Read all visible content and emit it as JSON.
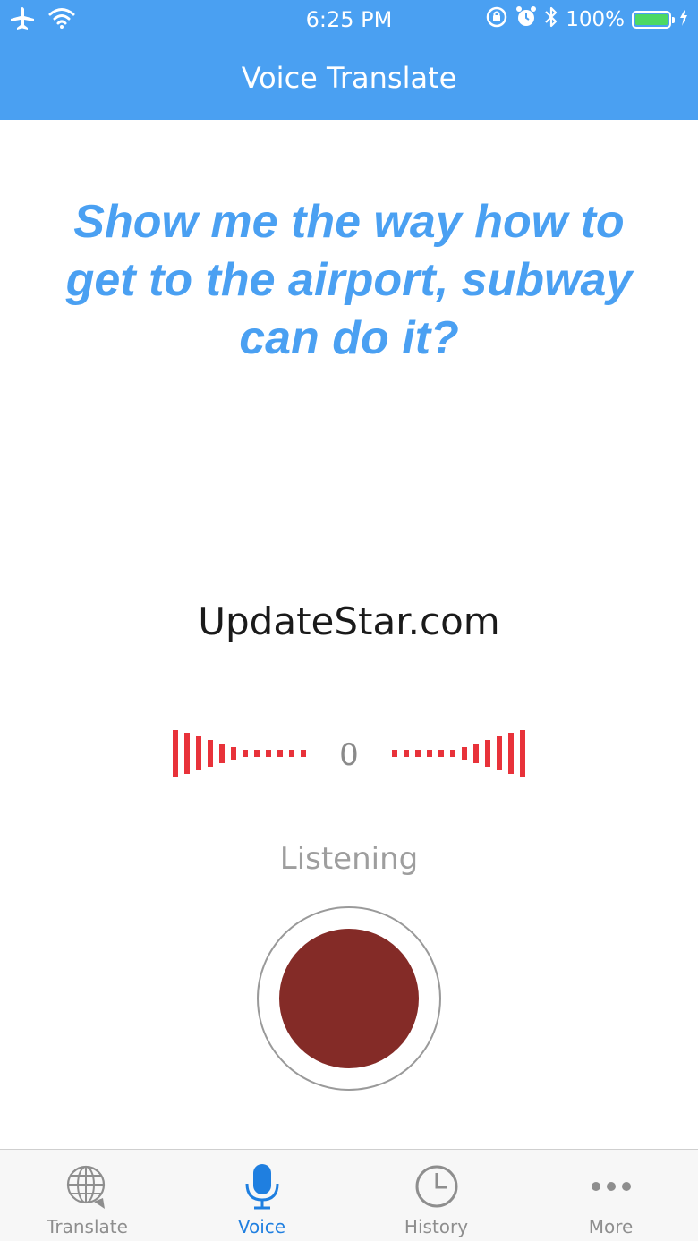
{
  "status_bar": {
    "time": "6:25 PM",
    "battery_text": "100%",
    "battery_level": 1.0
  },
  "nav": {
    "title": "Voice Translate"
  },
  "translation": {
    "text": "Show me the way how to get to the airport, subway can do it?"
  },
  "watermark": {
    "text": "UpdateStar.com"
  },
  "voice": {
    "level_value": "0",
    "status": "Listening"
  },
  "tabs": [
    {
      "label": "Translate",
      "icon": "globe-icon",
      "active": false
    },
    {
      "label": "Voice",
      "icon": "microphone-icon",
      "active": true
    },
    {
      "label": "History",
      "icon": "clock-icon",
      "active": false
    },
    {
      "label": "More",
      "icon": "more-icon",
      "active": false
    }
  ],
  "colors": {
    "header_blue": "#4aa0f2",
    "text_blue": "#4aa0f2",
    "meter_red": "#e8323a",
    "record_dot": "#842b27",
    "tab_active": "#1f7fe0",
    "tab_inactive": "#8e8e8e",
    "battery_green": "#4cd964"
  }
}
